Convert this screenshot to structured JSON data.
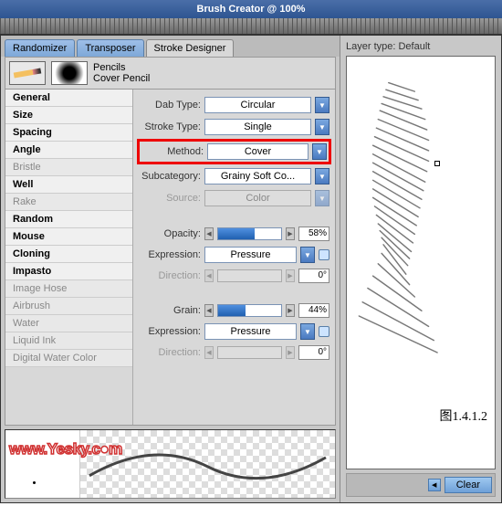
{
  "title": "Brush Creator @ 100%",
  "tabs": [
    "Randomizer",
    "Transposer",
    "Stroke Designer"
  ],
  "activeTab": 2,
  "brush": {
    "category": "Pencils",
    "name": "Cover Pencil"
  },
  "categories": [
    {
      "label": "General",
      "bold": true
    },
    {
      "label": "Size",
      "bold": true
    },
    {
      "label": "Spacing",
      "bold": true
    },
    {
      "label": "Angle",
      "bold": true
    },
    {
      "label": "Bristle",
      "dim": true
    },
    {
      "label": "Well",
      "bold": true
    },
    {
      "label": "Rake",
      "dim": true
    },
    {
      "label": "Random",
      "bold": true
    },
    {
      "label": "Mouse",
      "bold": true
    },
    {
      "label": "Cloning",
      "bold": true
    },
    {
      "label": "Impasto",
      "bold": true
    },
    {
      "label": "Image Hose",
      "dim": true
    },
    {
      "label": "Airbrush",
      "dim": true
    },
    {
      "label": "Water",
      "dim": true
    },
    {
      "label": "Liquid Ink",
      "dim": true
    },
    {
      "label": "Digital Water Color",
      "dim": true
    }
  ],
  "props": {
    "dabType": {
      "label": "Dab Type:",
      "value": "Circular"
    },
    "strokeType": {
      "label": "Stroke Type:",
      "value": "Single"
    },
    "method": {
      "label": "Method:",
      "value": "Cover"
    },
    "subcategory": {
      "label": "Subcategory:",
      "value": "Grainy Soft Co..."
    },
    "source": {
      "label": "Source:",
      "value": "Color",
      "dim": true
    },
    "opacity": {
      "label": "Opacity:",
      "pct": "58%",
      "fill": 58
    },
    "expr1": {
      "label": "Expression:",
      "value": "Pressure"
    },
    "dir1": {
      "label": "Direction:",
      "value": "0°",
      "dim": true
    },
    "grain": {
      "label": "Grain:",
      "pct": "44%",
      "fill": 44
    },
    "expr2": {
      "label": "Expression:",
      "value": "Pressure"
    },
    "dir2": {
      "label": "Direction:",
      "value": "0°",
      "dim": true
    }
  },
  "right": {
    "layerType": "Layer type: Default",
    "figLabel": "图1.4.1.2",
    "clear": "Clear"
  },
  "watermark": "www.Yesky.c●m"
}
